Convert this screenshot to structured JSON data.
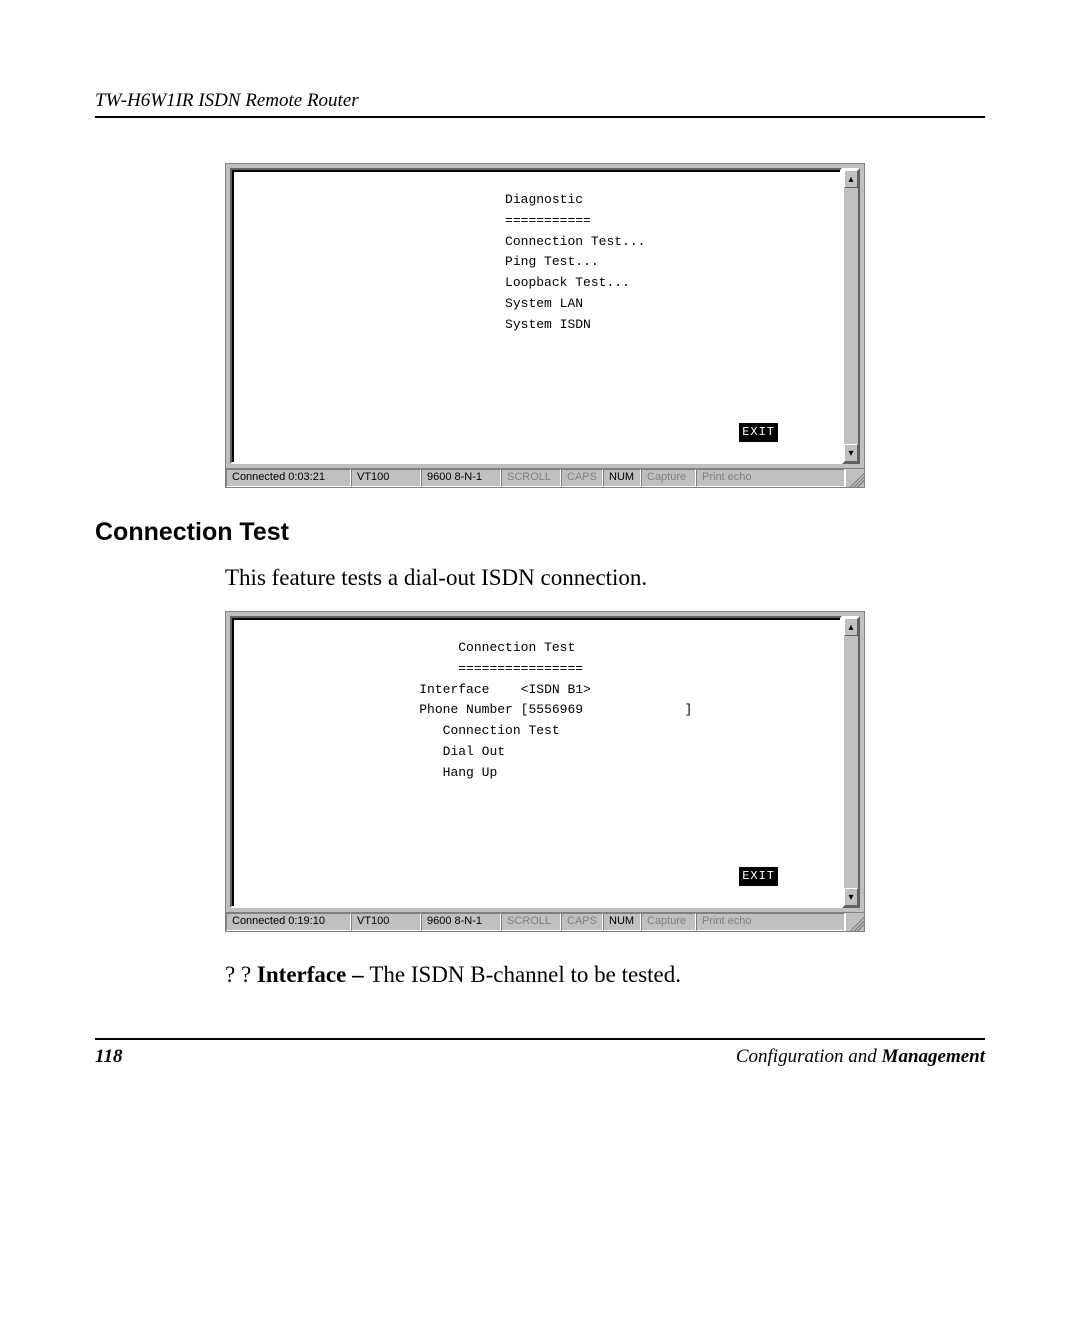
{
  "header": {
    "running": "TW-H6W1IR ISDN Remote Router"
  },
  "terminal1": {
    "title": "Diagnostic",
    "underline": "===========",
    "items": [
      "Connection Test...",
      "Ping Test...",
      "Loopback Test...",
      "System LAN",
      "System ISDN"
    ],
    "exit": "EXIT",
    "status": {
      "conn": "Connected 0:03:21",
      "term": "VT100",
      "port": "9600 8-N-1",
      "scroll": "SCROLL",
      "caps": "CAPS",
      "num": "NUM",
      "capture": "Capture",
      "printecho": "Print echo"
    }
  },
  "section": {
    "heading": "Connection Test",
    "intro": "This feature tests a dial-out ISDN connection."
  },
  "terminal2": {
    "title": "Connection Test",
    "underline": "================",
    "interface_label": "Interface",
    "interface_value": "<ISDN B1>",
    "phone_label": "Phone Number",
    "phone_value": "[5556969             ]",
    "actions": [
      "Connection Test",
      "Dial Out",
      "Hang Up"
    ],
    "exit": "EXIT",
    "status": {
      "conn": "Connected 0:19:10",
      "term": "VT100",
      "port": "9600 8-N-1",
      "scroll": "SCROLL",
      "caps": "CAPS",
      "num": "NUM",
      "capture": "Capture",
      "printecho": "Print echo"
    }
  },
  "bullet": {
    "lead": "? ? ",
    "term": "Interface – ",
    "desc": "The ISDN B-channel to be tested."
  },
  "footer": {
    "page": "118",
    "section_italic": "Configuration and ",
    "section_bold": "Management"
  }
}
